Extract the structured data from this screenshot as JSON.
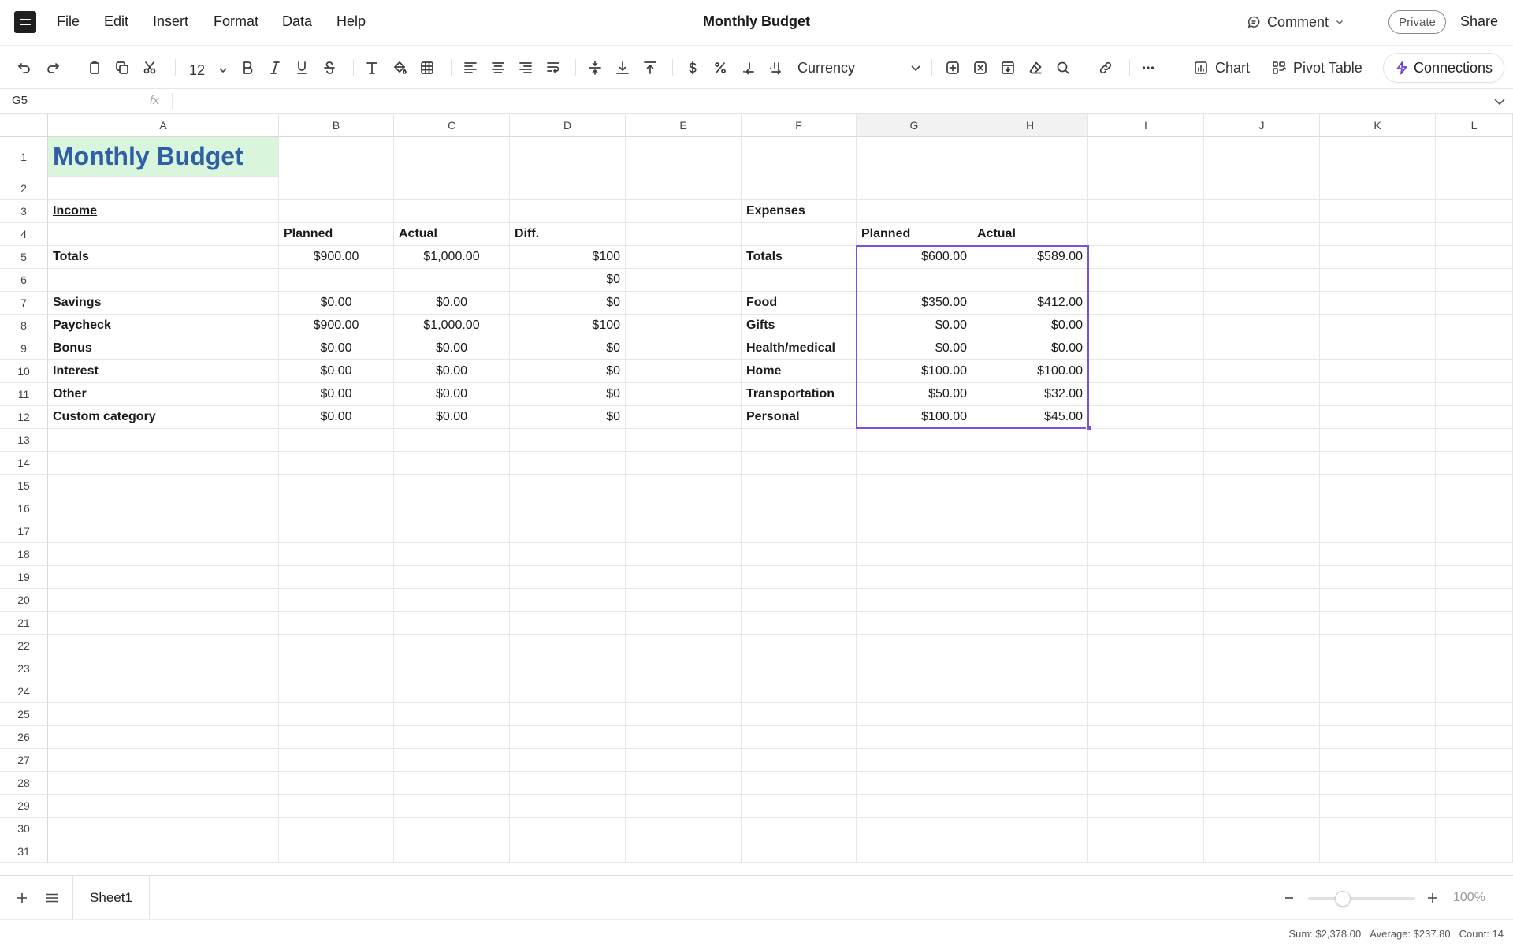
{
  "menubar": {
    "items": [
      "File",
      "Edit",
      "Insert",
      "Format",
      "Data",
      "Help"
    ],
    "title": "Monthly Budget",
    "comment_label": "Comment",
    "private_label": "Private",
    "share_label": "Share"
  },
  "toolbar": {
    "font_size": "12",
    "number_format": "Currency",
    "chart_label": "Chart",
    "pivot_label": "Pivot Table",
    "connections_label": "Connections"
  },
  "formula_bar": {
    "cell_ref": "G5",
    "fx_label": "fx",
    "value": ""
  },
  "columns": [
    "A",
    "B",
    "C",
    "D",
    "E",
    "F",
    "G",
    "H",
    "I",
    "J",
    "K",
    "L"
  ],
  "selected_columns": [
    "G",
    "H"
  ],
  "row_count": 31,
  "cells": [
    {
      "ref": "A1",
      "value": "Monthly Budget",
      "style": "title"
    },
    {
      "ref": "A3",
      "value": "Income",
      "style": "bold-underline"
    },
    {
      "ref": "F3",
      "value": "Expenses",
      "style": "bold"
    },
    {
      "ref": "B4",
      "value": "Planned",
      "style": "bold"
    },
    {
      "ref": "C4",
      "value": "Actual",
      "style": "bold"
    },
    {
      "ref": "D4",
      "value": "Diff.",
      "style": "bold"
    },
    {
      "ref": "G4",
      "value": "Planned",
      "style": "bold"
    },
    {
      "ref": "H4",
      "value": "Actual",
      "style": "bold"
    },
    {
      "ref": "A5",
      "value": "Totals",
      "style": "bold"
    },
    {
      "ref": "B5",
      "value": "$900.00",
      "style": "center"
    },
    {
      "ref": "C5",
      "value": "$1,000.00",
      "style": "center"
    },
    {
      "ref": "D5",
      "value": "$100",
      "style": "right"
    },
    {
      "ref": "F5",
      "value": "Totals",
      "style": "bold"
    },
    {
      "ref": "G5",
      "value": "$600.00",
      "style": "right"
    },
    {
      "ref": "H5",
      "value": "$589.00",
      "style": "right"
    },
    {
      "ref": "D6",
      "value": "$0",
      "style": "right"
    },
    {
      "ref": "A7",
      "value": "Savings",
      "style": "bold"
    },
    {
      "ref": "B7",
      "value": "$0.00",
      "style": "center"
    },
    {
      "ref": "C7",
      "value": "$0.00",
      "style": "center"
    },
    {
      "ref": "D7",
      "value": "$0",
      "style": "right"
    },
    {
      "ref": "F7",
      "value": "Food",
      "style": "bold"
    },
    {
      "ref": "G7",
      "value": "$350.00",
      "style": "right"
    },
    {
      "ref": "H7",
      "value": "$412.00",
      "style": "right"
    },
    {
      "ref": "A8",
      "value": "Paycheck",
      "style": "bold"
    },
    {
      "ref": "B8",
      "value": "$900.00",
      "style": "center"
    },
    {
      "ref": "C8",
      "value": "$1,000.00",
      "style": "center"
    },
    {
      "ref": "D8",
      "value": "$100",
      "style": "right"
    },
    {
      "ref": "F8",
      "value": "Gifts",
      "style": "bold"
    },
    {
      "ref": "G8",
      "value": "$0.00",
      "style": "right"
    },
    {
      "ref": "H8",
      "value": "$0.00",
      "style": "right"
    },
    {
      "ref": "A9",
      "value": "Bonus",
      "style": "bold"
    },
    {
      "ref": "B9",
      "value": "$0.00",
      "style": "center"
    },
    {
      "ref": "C9",
      "value": "$0.00",
      "style": "center"
    },
    {
      "ref": "D9",
      "value": "$0",
      "style": "right"
    },
    {
      "ref": "F9",
      "value": "Health/medical",
      "style": "bold"
    },
    {
      "ref": "G9",
      "value": "$0.00",
      "style": "right"
    },
    {
      "ref": "H9",
      "value": "$0.00",
      "style": "right"
    },
    {
      "ref": "A10",
      "value": "Interest",
      "style": "bold"
    },
    {
      "ref": "B10",
      "value": "$0.00",
      "style": "center"
    },
    {
      "ref": "C10",
      "value": "$0.00",
      "style": "center"
    },
    {
      "ref": "D10",
      "value": "$0",
      "style": "right"
    },
    {
      "ref": "F10",
      "value": "Home",
      "style": "bold"
    },
    {
      "ref": "G10",
      "value": "$100.00",
      "style": "right"
    },
    {
      "ref": "H10",
      "value": "$100.00",
      "style": "right"
    },
    {
      "ref": "A11",
      "value": "Other",
      "style": "bold"
    },
    {
      "ref": "B11",
      "value": "$0.00",
      "style": "center"
    },
    {
      "ref": "C11",
      "value": "$0.00",
      "style": "center"
    },
    {
      "ref": "D11",
      "value": "$0",
      "style": "right"
    },
    {
      "ref": "F11",
      "value": "Transportation",
      "style": "bold"
    },
    {
      "ref": "G11",
      "value": "$50.00",
      "style": "right"
    },
    {
      "ref": "H11",
      "value": "$32.00",
      "style": "right"
    },
    {
      "ref": "A12",
      "value": "Custom category",
      "style": "bold"
    },
    {
      "ref": "B12",
      "value": "$0.00",
      "style": "center"
    },
    {
      "ref": "C12",
      "value": "$0.00",
      "style": "center"
    },
    {
      "ref": "D12",
      "value": "$0",
      "style": "right"
    },
    {
      "ref": "F12",
      "value": "Personal",
      "style": "bold"
    },
    {
      "ref": "G12",
      "value": "$100.00",
      "style": "right"
    },
    {
      "ref": "H12",
      "value": "$45.00",
      "style": "right"
    }
  ],
  "selection": {
    "range": "G5:H12",
    "color": "#7b4fe0"
  },
  "colors": {
    "title_bg": "#d9f5dc",
    "title_text": "#2f5fa7",
    "accent": "#7b4fe0"
  },
  "sheets": [
    {
      "name": "Sheet1",
      "active": true
    }
  ],
  "zoom": {
    "level_label": "100%",
    "level": 100
  },
  "status": {
    "sum": "Sum: $2,378.00",
    "average": "Average: $237.80",
    "count": "Count: 14"
  }
}
